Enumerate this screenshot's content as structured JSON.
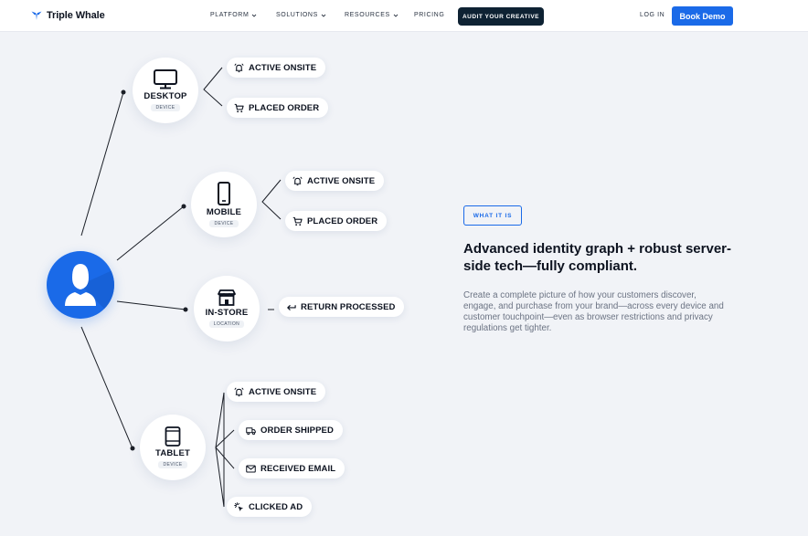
{
  "nav": {
    "brand": "Triple Whale",
    "links": [
      {
        "label": "PLATFORM"
      },
      {
        "label": "SOLUTIONS"
      },
      {
        "label": "RESOURCES"
      },
      {
        "label": "PRICING"
      }
    ],
    "audit_cta": "AUDIT YOUR CREATIVE",
    "login": "LOG IN",
    "demo_cta": "Book Demo",
    "brand_color": "#1a6ae8"
  },
  "diagram": {
    "nodes": {
      "desktop": {
        "title": "DESKTOP",
        "sub": "DEVICE",
        "icon": "monitor-icon"
      },
      "mobile": {
        "title": "MOBILE",
        "sub": "DEVICE",
        "icon": "smartphone-icon"
      },
      "instore": {
        "title": "IN-STORE",
        "sub": "LOCATION",
        "icon": "storefront-icon"
      },
      "tablet": {
        "title": "TABLET",
        "sub": "DEVICE",
        "icon": "tablet-icon"
      }
    },
    "events": {
      "desktop": [
        "ACTIVE ONSITE",
        "PLACED ORDER"
      ],
      "mobile": [
        "ACTIVE ONSITE",
        "PLACED ORDER"
      ],
      "instore": [
        "RETURN PROCESSED"
      ],
      "tablet": [
        "ACTIVE ONSITE",
        "ORDER SHIPPED",
        "RECEIVED EMAIL",
        "CLICKED AD"
      ]
    }
  },
  "content": {
    "badge": "WHAT IT IS",
    "headline": "Advanced identity graph + robust server-side tech—fully compliant.",
    "body": "Create a complete picture of how your customers discover, engage, and purchase from your brand—across every device and customer touchpoint—even as browser restrictions and privacy regulations get tighter."
  }
}
